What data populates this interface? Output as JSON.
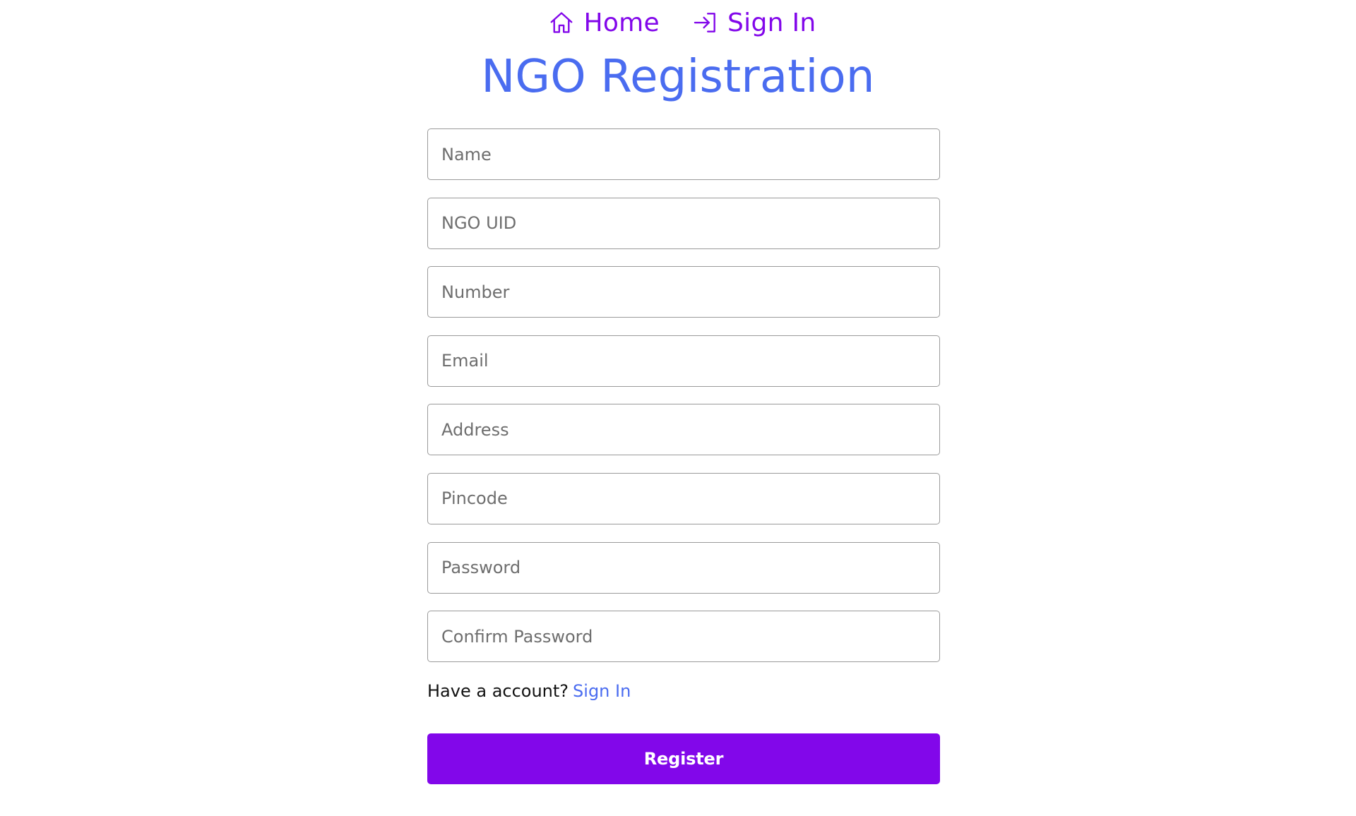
{
  "nav": {
    "home_label": "Home",
    "home_icon": "home-icon",
    "signin_label": "Sign In",
    "signin_icon": "sign-in-icon"
  },
  "title": "NGO Registration",
  "fields": {
    "name_placeholder": "Name",
    "uid_placeholder": "NGO UID",
    "number_placeholder": "Number",
    "email_placeholder": "Email",
    "address_placeholder": "Address",
    "pincode_placeholder": "Pincode",
    "password_placeholder": "Password",
    "confirm_placeholder": "Confirm Password"
  },
  "account": {
    "prompt": "Have a account?",
    "link": "Sign In"
  },
  "register_label": "Register",
  "colors": {
    "nav": "#8207ea",
    "title": "#4a6cf0",
    "link": "#4a6cf0",
    "button": "#8207ea"
  }
}
